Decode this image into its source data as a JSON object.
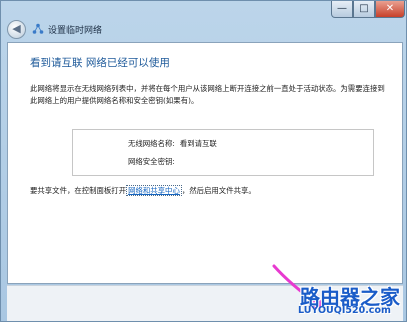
{
  "window": {
    "title": "设置临时网络",
    "controls": {
      "minimize": "—",
      "maximize": "□",
      "close": "✕"
    },
    "back_glyph": "◀"
  },
  "content": {
    "heading": "看到请互联 网络已经可以使用",
    "paragraph": "此网络将显示在无线网络列表中，并将在每个用户从该网络上断开连接之前一直处于活动状态。为需要连接到此网络上的用户提供网络名称和安全密钥(如果有)。",
    "info": {
      "name_label": "无线网络名称:",
      "name_value": "看到请互联",
      "key_label": "网络安全密钥:",
      "key_value": ""
    },
    "share": {
      "prefix": "要共享文件，在控制面板打开",
      "link": "网络和共享中心",
      "suffix": "，然后启用文件共享。"
    }
  },
  "watermark": {
    "brand": "路由器之家",
    "url": "LUYOUQI520.com"
  },
  "colors": {
    "heading": "#1e5a9a",
    "link": "#1565c0",
    "arrow": "#e83ad0",
    "watermark": "#1a5cc8"
  }
}
